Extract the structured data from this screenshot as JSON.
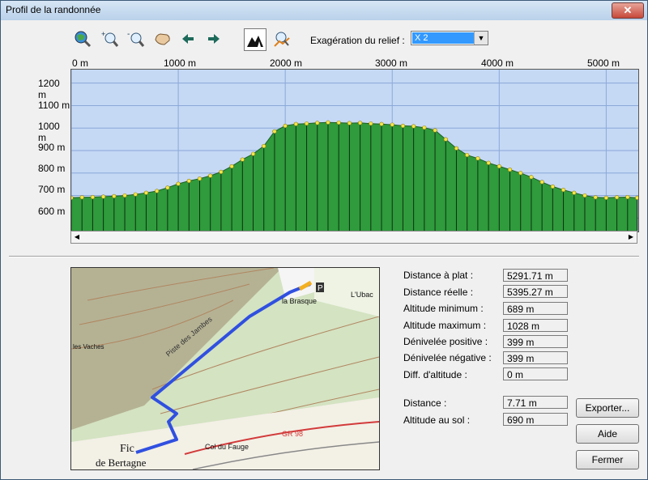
{
  "window": {
    "title": "Profil de la randonnée",
    "close_glyph": "✕"
  },
  "toolbar": {
    "icons": [
      "zoom-full-icon",
      "zoom-in-icon",
      "zoom-out-icon",
      "pan-hand-icon",
      "arrow-left-icon",
      "arrow-right-icon",
      "terrain-fill-icon",
      "walker-profile-icon"
    ],
    "exaggeration_label": "Exagération du relief :",
    "exaggeration_value": "X 2"
  },
  "chart_data": {
    "type": "area",
    "title": "",
    "xlabel": "",
    "ylabel": "",
    "x_ticks": [
      "0 m",
      "1000 m",
      "2000 m",
      "3000 m",
      "4000 m",
      "5000 m"
    ],
    "y_ticks": [
      "1200 m",
      "1100 m",
      "1000 m",
      "900 m",
      "800 m",
      "700 m",
      "600 m"
    ],
    "xlim": [
      0,
      5300
    ],
    "ylim": [
      540,
      1260
    ],
    "grid": true,
    "series": [
      {
        "x": [
          0,
          100,
          200,
          300,
          400,
          500,
          600,
          700,
          800,
          900,
          1000,
          1100,
          1200,
          1300,
          1400,
          1500,
          1600,
          1700,
          1800,
          1900,
          2000,
          2100,
          2200,
          2300,
          2400,
          2500,
          2600,
          2700,
          2800,
          2900,
          3000,
          3100,
          3200,
          3300,
          3400,
          3500,
          3600,
          3700,
          3800,
          3900,
          4000,
          4100,
          4200,
          4300,
          4400,
          4500,
          4600,
          4700,
          4800,
          4900,
          5000,
          5100,
          5200,
          5290
        ],
        "values": [
          690,
          692,
          693,
          695,
          697,
          700,
          705,
          712,
          720,
          735,
          752,
          765,
          775,
          788,
          805,
          830,
          860,
          885,
          920,
          985,
          1010,
          1018,
          1020,
          1023,
          1025,
          1024,
          1022,
          1023,
          1020,
          1018,
          1015,
          1010,
          1008,
          1002,
          990,
          950,
          910,
          880,
          865,
          845,
          830,
          815,
          800,
          782,
          760,
          740,
          725,
          712,
          700,
          692,
          690,
          692,
          693,
          690
        ]
      }
    ]
  },
  "stats": {
    "distance_plat_label": "Distance à plat :",
    "distance_plat": "5291.71 m",
    "distance_reelle_label": "Distance réelle :",
    "distance_reelle": "5395.27 m",
    "alt_min_label": "Altitude minimum :",
    "alt_min": "689 m",
    "alt_max_label": "Altitude maximum :",
    "alt_max": "1028 m",
    "den_pos_label": "Dénivelée positive :",
    "den_pos": "399 m",
    "den_neg_label": "Dénivelée négative :",
    "den_neg": "399 m",
    "diff_alt_label": "Diff. d'altitude :",
    "diff_alt": "0 m",
    "distance_label": "Distance :",
    "distance": "7.71 m",
    "alt_sol_label": "Altitude au sol :",
    "alt_sol": "690 m"
  },
  "buttons": {
    "export": "Exporter...",
    "help": "Aide",
    "close": "Fermer"
  },
  "map": {
    "labels": [
      "la Brasque",
      "L'Ubac",
      "Fic",
      "de Bertagne",
      "Col du Fauge",
      "GR 98",
      "Piste des Jambes",
      "les Vaches"
    ]
  },
  "colors": {
    "sky": "#c5d9f5",
    "terrain": "#2f9b3c",
    "track": "#3050e0",
    "marker": "#f5e64a"
  }
}
